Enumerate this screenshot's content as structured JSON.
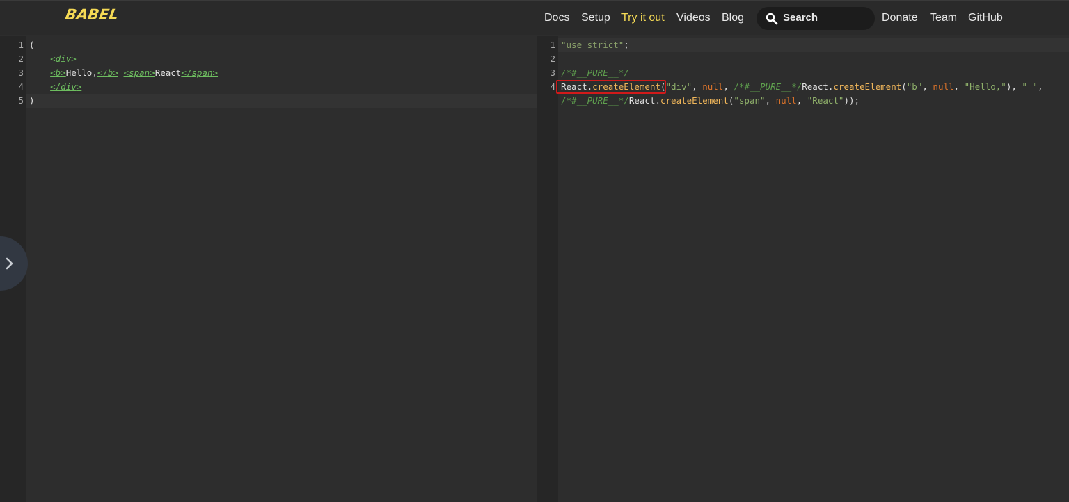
{
  "header": {
    "logo": "BABEL",
    "nav": [
      {
        "label": "Docs",
        "active": false
      },
      {
        "label": "Setup",
        "active": false
      },
      {
        "label": "Try it out",
        "active": true
      },
      {
        "label": "Videos",
        "active": false
      },
      {
        "label": "Blog",
        "active": false
      }
    ],
    "search_label": "Search",
    "nav_right": [
      {
        "label": "Donate"
      },
      {
        "label": "Team"
      },
      {
        "label": "GitHub"
      }
    ]
  },
  "input_editor": {
    "line_numbers": [
      "1",
      "2",
      "3",
      "4",
      "5"
    ],
    "lines": [
      [
        {
          "t": "(",
          "c": "pl"
        }
      ],
      [
        {
          "t": "    ",
          "c": "pl"
        },
        {
          "t": "<",
          "c": "brk"
        },
        {
          "t": "div",
          "c": "tag"
        },
        {
          "t": ">",
          "c": "brk"
        }
      ],
      [
        {
          "t": "    ",
          "c": "pl"
        },
        {
          "t": "<",
          "c": "brk"
        },
        {
          "t": "b",
          "c": "tag"
        },
        {
          "t": ">",
          "c": "brk"
        },
        {
          "t": "Hello,",
          "c": "pl"
        },
        {
          "t": "</",
          "c": "brk"
        },
        {
          "t": "b",
          "c": "tag"
        },
        {
          "t": ">",
          "c": "brk"
        },
        {
          "t": " ",
          "c": "pl"
        },
        {
          "t": "<",
          "c": "brk"
        },
        {
          "t": "span",
          "c": "tag"
        },
        {
          "t": ">",
          "c": "brk"
        },
        {
          "t": "React",
          "c": "pl"
        },
        {
          "t": "</",
          "c": "brk"
        },
        {
          "t": "span",
          "c": "tag"
        },
        {
          "t": ">",
          "c": "brk"
        }
      ],
      [
        {
          "t": "    ",
          "c": "pl"
        },
        {
          "t": "</",
          "c": "brk"
        },
        {
          "t": "div",
          "c": "tag"
        },
        {
          "t": ">",
          "c": "brk"
        }
      ],
      [
        {
          "t": ")",
          "c": "pl"
        }
      ]
    ],
    "active_line": 5
  },
  "output_editor": {
    "line_numbers": [
      "1",
      "2",
      "3",
      "4",
      ""
    ],
    "lines": [
      [
        {
          "t": "\"use strict\"",
          "c": "strict"
        },
        {
          "t": ";",
          "c": "pl"
        }
      ],
      [],
      [
        {
          "t": "/*#__PURE__*/",
          "c": "cmt"
        }
      ],
      [
        {
          "t": "React.",
          "c": "pl"
        },
        {
          "t": "createElement",
          "c": "fn"
        },
        {
          "t": "(",
          "c": "pl"
        },
        {
          "t": "\"div\"",
          "c": "str"
        },
        {
          "t": ", ",
          "c": "pl"
        },
        {
          "t": "null",
          "c": "kw"
        },
        {
          "t": ", ",
          "c": "pl"
        },
        {
          "t": "/*#__PURE__*/",
          "c": "cmt"
        },
        {
          "t": "React.",
          "c": "pl"
        },
        {
          "t": "createElement",
          "c": "fn"
        },
        {
          "t": "(",
          "c": "pl"
        },
        {
          "t": "\"b\"",
          "c": "str"
        },
        {
          "t": ", ",
          "c": "pl"
        },
        {
          "t": "null",
          "c": "kw"
        },
        {
          "t": ", ",
          "c": "pl"
        },
        {
          "t": "\"Hello,\"",
          "c": "str"
        },
        {
          "t": "), ",
          "c": "pl"
        },
        {
          "t": "\" \"",
          "c": "str"
        },
        {
          "t": ",",
          "c": "pl"
        }
      ],
      [
        {
          "t": "/*#__PURE__*/",
          "c": "cmt"
        },
        {
          "t": "React.",
          "c": "pl"
        },
        {
          "t": "createElement",
          "c": "fn"
        },
        {
          "t": "(",
          "c": "pl"
        },
        {
          "t": "\"span\"",
          "c": "str"
        },
        {
          "t": ", ",
          "c": "pl"
        },
        {
          "t": "null",
          "c": "kw"
        },
        {
          "t": ", ",
          "c": "pl"
        },
        {
          "t": "\"React\"",
          "c": "str"
        },
        {
          "t": "));",
          "c": "pl"
        }
      ]
    ],
    "active_line": 1
  },
  "colors": {
    "accent": "#f5da55",
    "highlight_box": "#d11a1a"
  },
  "icons": {
    "search": "search-icon",
    "sidebar_toggle": "chevron-right-icon"
  }
}
